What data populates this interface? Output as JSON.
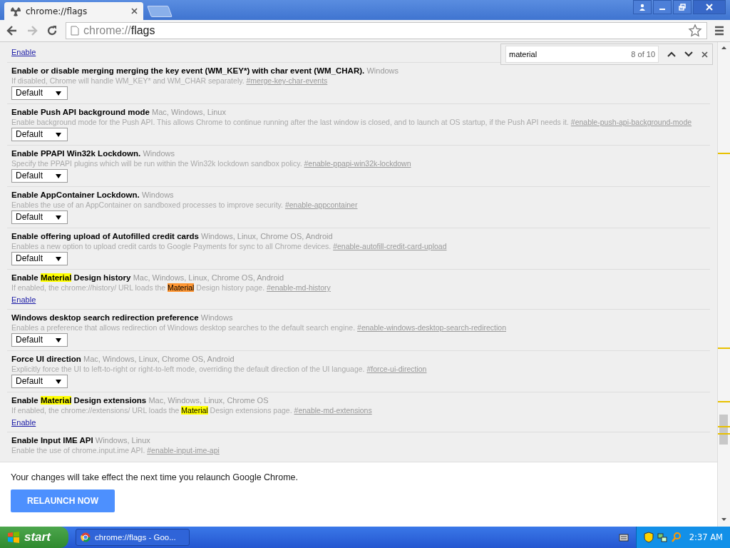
{
  "tab": {
    "title": "chrome://flags"
  },
  "address": {
    "prefix": "chrome://",
    "path": "flags"
  },
  "find_bar": {
    "query": "material",
    "count": "8 of 10"
  },
  "top_link": "Enable",
  "experiments": [
    {
      "title": [
        {
          "text": "Enable or disable merging merging the key event (WM_KEY*) with char event (WM_CHAR)."
        }
      ],
      "platforms": "Windows",
      "description": [
        {
          "text": "If disabled, Chrome will handle WM_KEY* and WM_CHAR separately."
        }
      ],
      "anchor": "#merge-key-char-events",
      "kind": "select",
      "value": "Default"
    },
    {
      "title": [
        {
          "text": "Enable Push API background mode"
        }
      ],
      "platforms": "Mac, Windows, Linux",
      "description": [
        {
          "text": "Enable background mode for the Push API. This allows Chrome to continue running after the last window is closed, and to launch at OS startup, if the Push API needs it."
        }
      ],
      "anchor": "#enable-push-api-background-mode",
      "kind": "select",
      "value": "Default"
    },
    {
      "title": [
        {
          "text": "Enable PPAPI Win32k Lockdown."
        }
      ],
      "platforms": "Windows",
      "description": [
        {
          "text": "Specify the PPAPI plugins which will be run within the Win32k lockdown sandbox policy."
        }
      ],
      "anchor": "#enable-ppapi-win32k-lockdown",
      "kind": "select",
      "value": "Default"
    },
    {
      "title": [
        {
          "text": "Enable AppContainer Lockdown."
        }
      ],
      "platforms": "Windows",
      "description": [
        {
          "text": "Enables the use of an AppContainer on sandboxed processes to improve security."
        }
      ],
      "anchor": "#enable-appcontainer",
      "kind": "select",
      "value": "Default"
    },
    {
      "title": [
        {
          "text": "Enable offering upload of Autofilled credit cards"
        }
      ],
      "platforms": "Windows, Linux, Chrome OS, Android",
      "description": [
        {
          "text": "Enables a new option to upload credit cards to Google Payments for sync to all Chrome devices."
        }
      ],
      "anchor": "#enable-autofill-credit-card-upload",
      "kind": "select",
      "value": "Default"
    },
    {
      "title": [
        {
          "text": "Enable ",
          "highlighted": false,
          "active": false
        },
        {
          "text": "Material",
          "highlighted": true,
          "active": false
        },
        {
          "text": " Design history",
          "highlighted": false,
          "active": false
        }
      ],
      "platforms": "Mac, Windows, Linux, Chrome OS, Android",
      "description": [
        {
          "text": "If enabled, the chrome://history/ URL loads the ",
          "highlighted": false,
          "active": false
        },
        {
          "text": "Material",
          "highlighted": true,
          "active": true
        },
        {
          "text": " Design history page.",
          "highlighted": false,
          "active": false
        }
      ],
      "anchor": "#enable-md-history",
      "kind": "link",
      "value": "Enable"
    },
    {
      "title": [
        {
          "text": "Windows desktop search redirection preference"
        }
      ],
      "platforms": "Windows",
      "description": [
        {
          "text": "Enables a preference that allows redirection of Windows desktop searches to the default search engine."
        }
      ],
      "anchor": "#enable-windows-desktop-search-redirection",
      "kind": "select",
      "value": "Default"
    },
    {
      "title": [
        {
          "text": "Force UI direction"
        }
      ],
      "platforms": "Mac, Windows, Linux, Chrome OS, Android",
      "description": [
        {
          "text": "Explicitly force the UI to left-to-right or right-to-left mode, overriding the default direction of the UI language."
        }
      ],
      "anchor": "#force-ui-direction",
      "kind": "select",
      "value": "Default"
    },
    {
      "title": [
        {
          "text": "Enable ",
          "highlighted": false,
          "active": false
        },
        {
          "text": "Material",
          "highlighted": true,
          "active": false
        },
        {
          "text": " Design extensions",
          "highlighted": false,
          "active": false
        }
      ],
      "platforms": "Mac, Windows, Linux, Chrome OS",
      "description": [
        {
          "text": "If enabled, the chrome://extensions/ URL loads the ",
          "highlighted": false,
          "active": false
        },
        {
          "text": "Material",
          "highlighted": true,
          "active": false
        },
        {
          "text": " Design extensions page.",
          "highlighted": false,
          "active": false
        }
      ],
      "anchor": "#enable-md-extensions",
      "kind": "link",
      "value": "Enable"
    },
    {
      "title": [
        {
          "text": "Enable Input IME API"
        }
      ],
      "platforms": "Windows, Linux",
      "description": [
        {
          "text": "Enable the use of chrome.input.ime API."
        }
      ],
      "anchor": "#enable-input-ime-api",
      "kind": "none"
    }
  ],
  "relaunch": {
    "message": "Your changes will take effect the next time you relaunch Google Chrome.",
    "button": "RELAUNCH NOW"
  },
  "taskbar": {
    "start": "start",
    "task": "chrome://flags - Goo...",
    "clock": "2:37 AM"
  }
}
